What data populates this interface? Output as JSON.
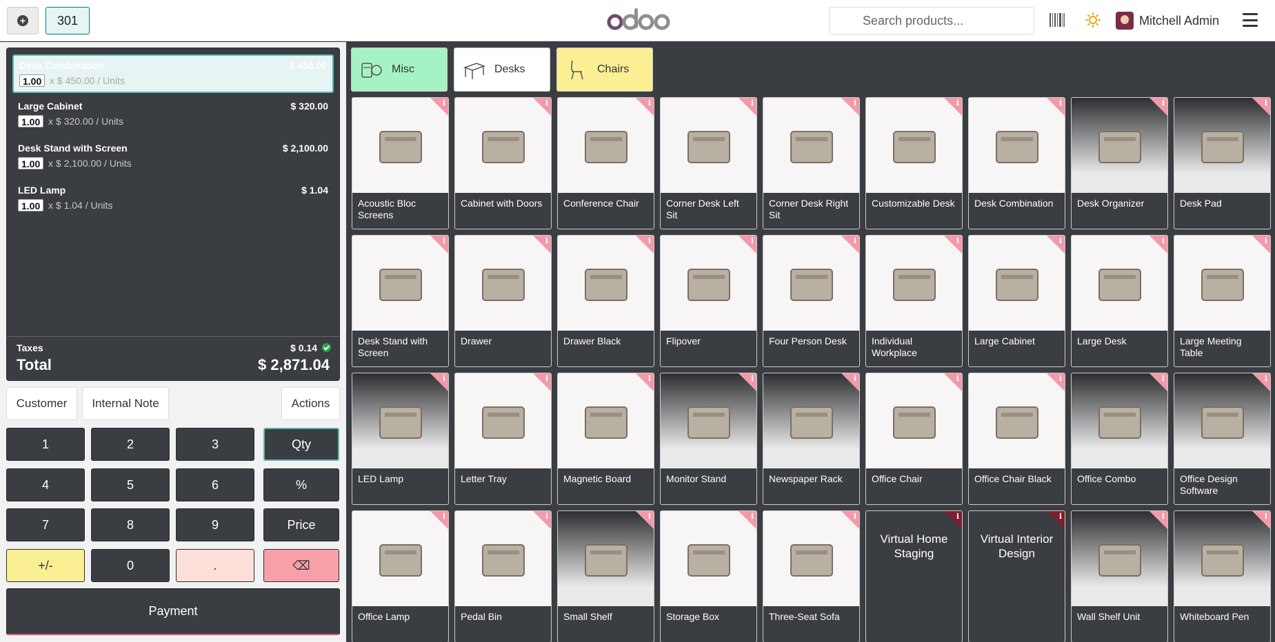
{
  "header": {
    "order_number": "301",
    "search_placeholder": "Search products...",
    "user_name": "Mitchell Admin"
  },
  "order": {
    "lines": [
      {
        "name": "Desk Combination",
        "price": "$ 450.00",
        "qty": "1.00",
        "unit": "x $ 450.00 / Units"
      },
      {
        "name": "Large Cabinet",
        "price": "$ 320.00",
        "qty": "1.00",
        "unit": "x $ 320.00 / Units"
      },
      {
        "name": "Desk Stand with Screen",
        "price": "$ 2,100.00",
        "qty": "1.00",
        "unit": "x $ 2,100.00 / Units"
      },
      {
        "name": "LED Lamp",
        "price": "$ 1.04",
        "qty": "1.00",
        "unit": "x $ 1.04 / Units"
      }
    ],
    "taxes_label": "Taxes",
    "taxes_value": "$ 0.14",
    "total_label": "Total",
    "total_value": "$ 2,871.04"
  },
  "controls": {
    "customer": "Customer",
    "internal_note": "Internal Note",
    "actions": "Actions"
  },
  "numpad": {
    "k1": "1",
    "k2": "2",
    "k3": "3",
    "qty": "Qty",
    "k4": "4",
    "k5": "5",
    "k6": "6",
    "pct": "%",
    "k7": "7",
    "k8": "8",
    "k9": "9",
    "price": "Price",
    "sign": "+/-",
    "k0": "0",
    "dot": ".",
    "del": "⌫"
  },
  "payment": "Payment",
  "categories": [
    {
      "label": "Misc",
      "color": "#a5f2c4"
    },
    {
      "label": "Desks",
      "color": "#ffffff"
    },
    {
      "label": "Chairs",
      "color": "#fbef94"
    }
  ],
  "products": [
    [
      "Acoustic Bloc Screens",
      "Cabinet with Doors",
      "Conference Chair",
      "Corner Desk Left Sit",
      "Corner Desk Right Sit",
      "Customizable Desk",
      "Desk Combination",
      "Desk Organizer",
      "Desk Pad"
    ],
    [
      "Desk Stand with Screen",
      "Drawer",
      "Drawer Black",
      "Flipover",
      "Four Person Desk",
      "Individual Workplace",
      "Large Cabinet",
      "Large Desk",
      "Large Meeting Table"
    ],
    [
      "LED Lamp",
      "Letter Tray",
      "Magnetic Board",
      "Monitor Stand",
      "Newspaper Rack",
      "Office Chair",
      "Office Chair Black",
      "Office Combo",
      "Office Design Software"
    ],
    [
      "Office Lamp",
      "Pedal Bin",
      "Small Shelf",
      "Storage Box",
      "Three-Seat Sofa",
      "Virtual Home Staging",
      "Virtual Interior Design",
      "Wall Shelf Unit",
      "Whiteboard Pen"
    ]
  ],
  "info_glyph": "i"
}
